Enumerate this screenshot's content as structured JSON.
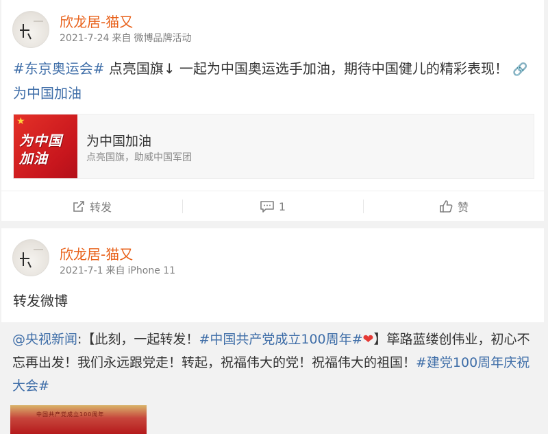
{
  "posts": [
    {
      "author": "欣龙居-猫又",
      "date": "2021-7-24",
      "source_prefix": "来自",
      "source": "微博品牌活动",
      "text": {
        "topic": "#东京奥运会#",
        "body": " 点亮国旗↓ 一起为中国奥运选手加油，期待中国健儿的精彩表现！",
        "link_label": "为中国加油"
      },
      "link_card": {
        "thumb_line1": "为中国",
        "thumb_line2": "加油",
        "title": "为中国加油",
        "subtitle": "点亮国旗，助威中国军团"
      },
      "actions": {
        "repost_label": "转发",
        "comment_count": "1",
        "like_label": "赞"
      }
    },
    {
      "author": "欣龙居-猫又",
      "date": "2021-7-1",
      "source_prefix": "来自",
      "source": "iPhone 11",
      "text": "转发微博",
      "repost": {
        "mention": "@央视新闻",
        "colon": ":",
        "part1": "【此刻，一起转发！",
        "topic1": "#中国共产党成立100周年#",
        "part2": "】筚路蓝缕创伟业，初心不忘再出发！我们永远跟党走！转起，祝福伟大的党！祝福伟大的祖国！",
        "topic2": "#建党100周年庆祝大会#",
        "thumb_caption": "中国共产党成立100周年"
      }
    }
  ],
  "icons": {
    "link": "link-icon",
    "repost": "repost-icon",
    "comment": "comment-icon",
    "like": "thumbs-up-icon",
    "heart": "heart-icon",
    "star": "star-icon"
  },
  "colors": {
    "author": "#e8611a",
    "topic": "#3f6ea8",
    "meta": "#808080",
    "thumb_red": "#c8161d"
  }
}
